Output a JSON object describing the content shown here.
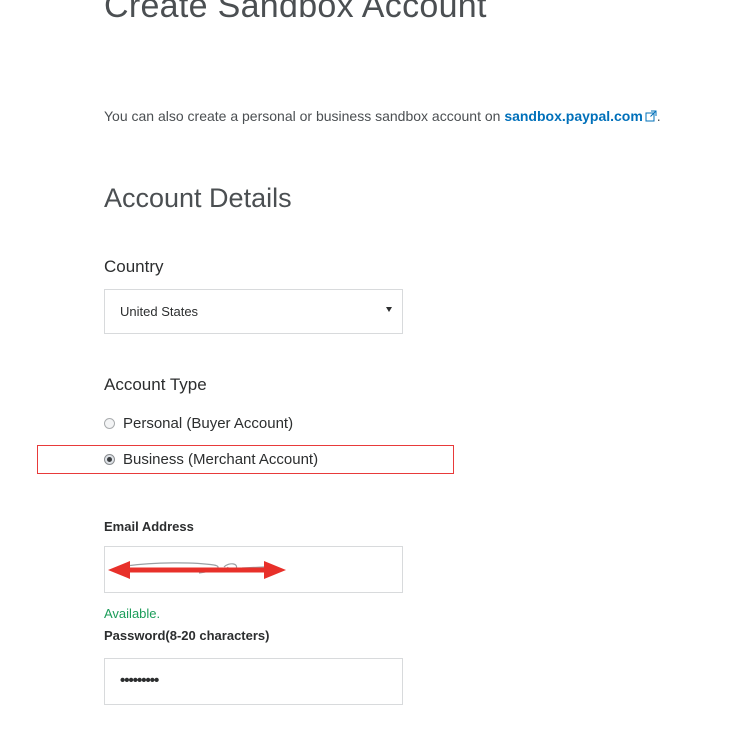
{
  "page": {
    "title": "Create Sandbox Account"
  },
  "info": {
    "prefix": "You can also create a personal or business sandbox account on ",
    "link_text": "sandbox.paypal.com",
    "suffix": "."
  },
  "account_details": {
    "section_title": "Account Details",
    "country": {
      "label": "Country",
      "selected": "United States"
    },
    "account_type": {
      "label": "Account Type",
      "options": [
        {
          "label": "Personal (Buyer Account)",
          "checked": false
        },
        {
          "label": "Business (Merchant Account)",
          "checked": true
        }
      ]
    },
    "email": {
      "label": "Email Address",
      "value": "",
      "status": "Available."
    },
    "password": {
      "label": "Password(8-20 characters)",
      "value": "•••••••••"
    }
  },
  "annotation": {
    "highlight_color": "#e83a3a",
    "arrow_color": "#e8302a"
  },
  "colors": {
    "link": "#0070ba",
    "success": "#1c9d5a"
  },
  "icons": {
    "external_link": "external-link-icon",
    "select_caret": "chevron-down-icon"
  }
}
